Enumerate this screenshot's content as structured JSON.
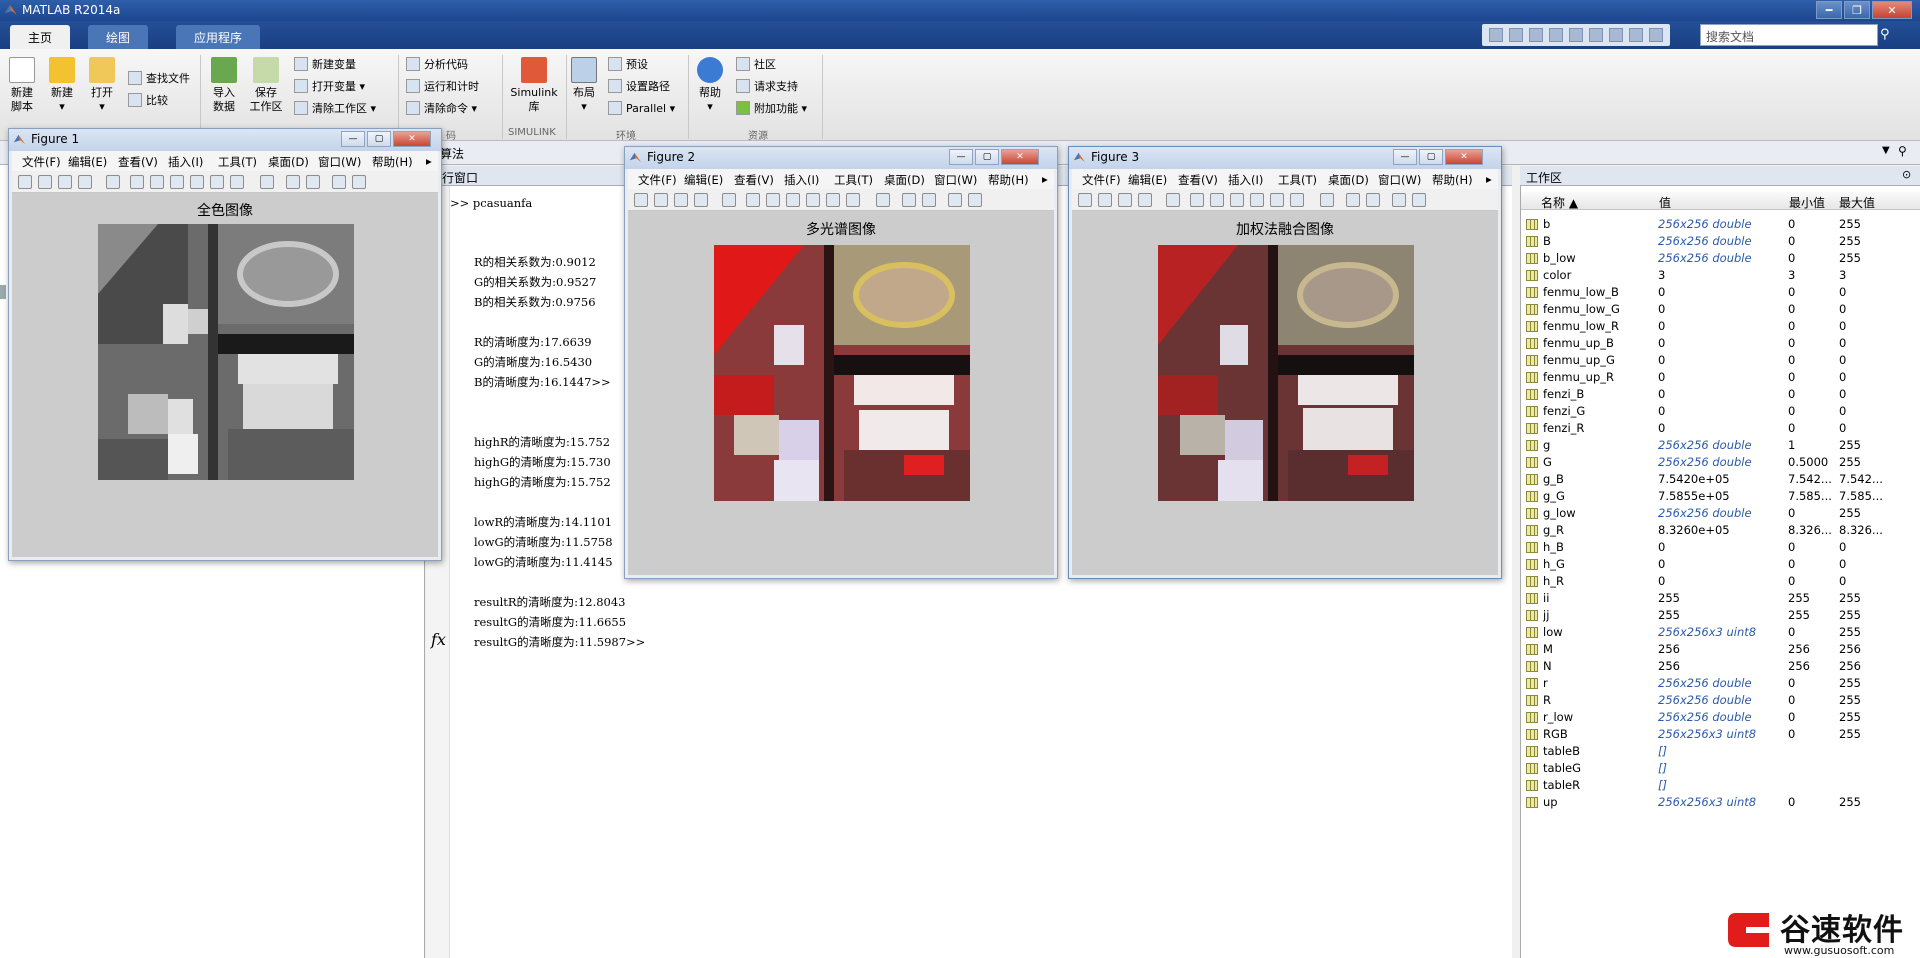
{
  "app": {
    "title": "MATLAB R2014a"
  },
  "tabs": [
    {
      "label": "主页"
    },
    {
      "label": "绘图"
    },
    {
      "label": "应用程序"
    }
  ],
  "search": {
    "placeholder": "搜索文档"
  },
  "ribbon": {
    "new_script": "新建\n脚本",
    "new": "新建",
    "open": "打开",
    "find_files": "查找文件",
    "compare": "比较",
    "import": "导入\n数据",
    "save_workspace": "保存\n工作区",
    "new_variable": "新建变量",
    "open_variable": "打开变量",
    "clear_workspace": "清除工作区",
    "analyze_code": "分析代码",
    "run_and_time": "运行和计时",
    "clear_commands": "清除命令",
    "simulink": "Simulink\n库",
    "layout": "布局",
    "preferences": "预设",
    "set_path": "设置路径",
    "parallel": "Parallel",
    "help": "帮助",
    "community": "社区",
    "request_support": "请求支持",
    "add_ons": "附加功能",
    "section_code": "码",
    "section_simulink": "SIMULINK",
    "section_env": "环境",
    "section_resources": "资源"
  },
  "address": {
    "text": "算法"
  },
  "command_window": {
    "title": "令行窗口",
    "lines": [
      ">> pcasuanfa",
      "R的相关系数为:0.9012",
      "G的相关系数为:0.9527",
      "B的相关系数为:0.9756",
      "R的清晰度为:17.6639",
      "G的清晰度为:16.5430",
      "B的清晰度为:16.1447>>",
      "highR的清晰度为:15.752",
      "highG的清晰度为:15.730",
      "highG的清晰度为:15.752",
      "lowR的清晰度为:14.1101",
      "lowG的清晰度为:11.5758",
      "lowG的清晰度为:11.4145",
      "resultR的清晰度为:12.8043",
      "resultG的清晰度为:11.6655",
      "resultG的清晰度为:11.5987>>"
    ],
    "fx": "fx"
  },
  "workspace": {
    "title": "工作区",
    "columns": {
      "name": "名称 ▲",
      "value": "值",
      "min": "最小值",
      "max": "最大值"
    },
    "rows": [
      {
        "name": "b",
        "value": "256x256 double",
        "min": "0",
        "max": "255",
        "it": true
      },
      {
        "name": "B",
        "value": "256x256 double",
        "min": "0",
        "max": "255",
        "it": true
      },
      {
        "name": "b_low",
        "value": "256x256 double",
        "min": "0",
        "max": "255",
        "it": true
      },
      {
        "name": "color",
        "value": "3",
        "min": "3",
        "max": "3",
        "it": false
      },
      {
        "name": "fenmu_low_B",
        "value": "0",
        "min": "0",
        "max": "0",
        "it": false
      },
      {
        "name": "fenmu_low_G",
        "value": "0",
        "min": "0",
        "max": "0",
        "it": false
      },
      {
        "name": "fenmu_low_R",
        "value": "0",
        "min": "0",
        "max": "0",
        "it": false
      },
      {
        "name": "fenmu_up_B",
        "value": "0",
        "min": "0",
        "max": "0",
        "it": false
      },
      {
        "name": "fenmu_up_G",
        "value": "0",
        "min": "0",
        "max": "0",
        "it": false
      },
      {
        "name": "fenmu_up_R",
        "value": "0",
        "min": "0",
        "max": "0",
        "it": false
      },
      {
        "name": "fenzi_B",
        "value": "0",
        "min": "0",
        "max": "0",
        "it": false
      },
      {
        "name": "fenzi_G",
        "value": "0",
        "min": "0",
        "max": "0",
        "it": false
      },
      {
        "name": "fenzi_R",
        "value": "0",
        "min": "0",
        "max": "0",
        "it": false
      },
      {
        "name": "g",
        "value": "256x256 double",
        "min": "1",
        "max": "255",
        "it": true
      },
      {
        "name": "G",
        "value": "256x256 double",
        "min": "0.5000",
        "max": "255",
        "it": true
      },
      {
        "name": "g_B",
        "value": "7.5420e+05",
        "min": "7.542...",
        "max": "7.542...",
        "it": false
      },
      {
        "name": "g_G",
        "value": "7.5855e+05",
        "min": "7.585...",
        "max": "7.585...",
        "it": false
      },
      {
        "name": "g_low",
        "value": "256x256 double",
        "min": "0",
        "max": "255",
        "it": true
      },
      {
        "name": "g_R",
        "value": "8.3260e+05",
        "min": "8.326...",
        "max": "8.326...",
        "it": false
      },
      {
        "name": "h_B",
        "value": "0",
        "min": "0",
        "max": "0",
        "it": false
      },
      {
        "name": "h_G",
        "value": "0",
        "min": "0",
        "max": "0",
        "it": false
      },
      {
        "name": "h_R",
        "value": "0",
        "min": "0",
        "max": "0",
        "it": false
      },
      {
        "name": "ii",
        "value": "255",
        "min": "255",
        "max": "255",
        "it": false
      },
      {
        "name": "jj",
        "value": "255",
        "min": "255",
        "max": "255",
        "it": false
      },
      {
        "name": "low",
        "value": "256x256x3 uint8",
        "min": "0",
        "max": "255",
        "it": true
      },
      {
        "name": "M",
        "value": "256",
        "min": "256",
        "max": "256",
        "it": false
      },
      {
        "name": "N",
        "value": "256",
        "min": "256",
        "max": "256",
        "it": false
      },
      {
        "name": "r",
        "value": "256x256 double",
        "min": "0",
        "max": "255",
        "it": true
      },
      {
        "name": "R",
        "value": "256x256 double",
        "min": "0",
        "max": "255",
        "it": true
      },
      {
        "name": "r_low",
        "value": "256x256 double",
        "min": "0",
        "max": "255",
        "it": true
      },
      {
        "name": "RGB",
        "value": "256x256x3 uint8",
        "min": "0",
        "max": "255",
        "it": true
      },
      {
        "name": "tableB",
        "value": "[]",
        "min": "",
        "max": "",
        "it": true
      },
      {
        "name": "tableG",
        "value": "[]",
        "min": "",
        "max": "",
        "it": true
      },
      {
        "name": "tableR",
        "value": "[]",
        "min": "",
        "max": "",
        "it": true
      },
      {
        "name": "up",
        "value": "256x256x3 uint8",
        "min": "0",
        "max": "255",
        "it": true
      }
    ]
  },
  "figure_menu": [
    "文件(F)",
    "编辑(E)",
    "查看(V)",
    "插入(I)",
    "工具(T)",
    "桌面(D)",
    "窗口(W)",
    "帮助(H)"
  ],
  "figures": [
    {
      "title": "Figure 1",
      "caption": "全色图像"
    },
    {
      "title": "Figure 2",
      "caption": "多光谱图像"
    },
    {
      "title": "Figure 3",
      "caption": "加权法融合图像"
    }
  ],
  "watermark": {
    "title": "谷速软件",
    "url": "www.gusuosoft.com"
  },
  "colors": {
    "titlebar": "#1d4590",
    "variable_link": "#2c5aa8",
    "figure_bg": "#cccccc"
  }
}
